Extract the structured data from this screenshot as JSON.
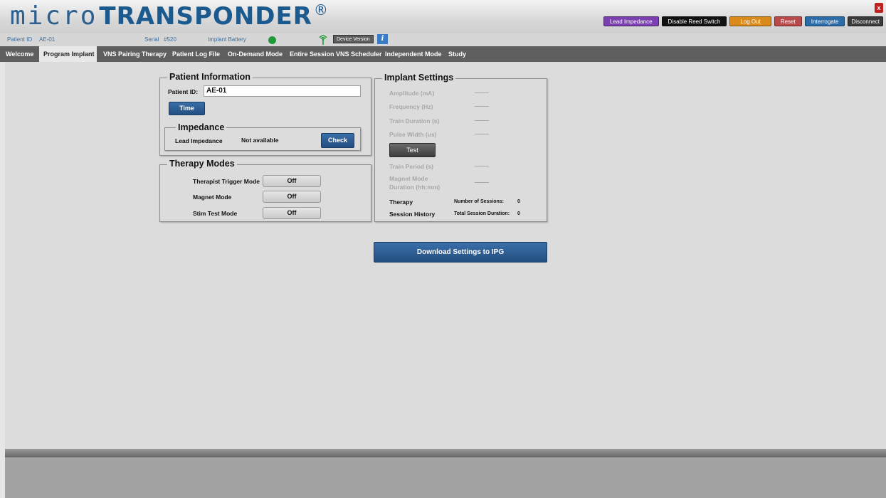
{
  "header": {
    "logo_micro": "micro",
    "logo_transponder": "TRANSPONDER",
    "logo_reg": "®",
    "buttons": {
      "lead_impedance": "Lead Impedance",
      "disable_reed": "Disable Reed Switch",
      "log_out": "Log Out",
      "reset": "Reset",
      "interrogate": "Interrogate",
      "disconnect": "Disconnect"
    },
    "close": "x",
    "colors": {
      "lead_impedance": "#7b3fb0",
      "disable_reed": "#111111",
      "log_out": "#d98a1a",
      "reset": "#b84a4a",
      "interrogate": "#2a6ba8",
      "disconnect": "#3a3a3a"
    }
  },
  "infobar": {
    "patient_id_label": "Patient ID",
    "patient_id_value": "AE-01",
    "serial_label": "Serial",
    "serial_value": "#520",
    "battery_label": "Implant Battery",
    "battery_color": "#1f9a3a",
    "device_version": "Device Version",
    "info": "i"
  },
  "nav": {
    "tabs": [
      {
        "label": "Welcome"
      },
      {
        "label": "Program Implant"
      },
      {
        "label": "VNS Pairing Therapy"
      },
      {
        "label": "Patient Log File"
      },
      {
        "label": "On-Demand Mode"
      },
      {
        "label": "Entire Session VNS Scheduler"
      },
      {
        "label": "Independent Mode"
      },
      {
        "label": "Study"
      }
    ]
  },
  "patient_info": {
    "title": "Patient Information",
    "patient_id_label": "Patient ID:",
    "patient_id_value": "AE-01",
    "time_button": "Time"
  },
  "impedance": {
    "title": "Impedance",
    "lead_label": "Lead Impedance",
    "lead_value": "Not available",
    "check_button": "Check"
  },
  "therapy_modes": {
    "title": "Therapy Modes",
    "rows": [
      {
        "label": "Therapist Trigger Mode",
        "value": "Off"
      },
      {
        "label": "Magnet Mode",
        "value": "Off"
      },
      {
        "label": "Stim Test Mode",
        "value": "Off"
      }
    ]
  },
  "implant_settings": {
    "title": "Implant Settings",
    "amplitude": "Amplitude (mA)",
    "frequency": "Frequency (Hz)",
    "train_duration": "Train Duration (s)",
    "pulse_width": "Pulse Width (us)",
    "test_button": "Test",
    "train_period": "Train Period (s)",
    "magnet_mode_1": "Magnet Mode",
    "magnet_mode_2": "Duration (hh:mm)",
    "therapy_label": "Therapy",
    "session_history_label": "Session History",
    "num_sessions_label": "Number of Sessions:",
    "num_sessions_value": "0",
    "total_duration_label": "Total Session Duration:",
    "total_duration_value": "0"
  },
  "download_button": "Download Settings to IPG"
}
